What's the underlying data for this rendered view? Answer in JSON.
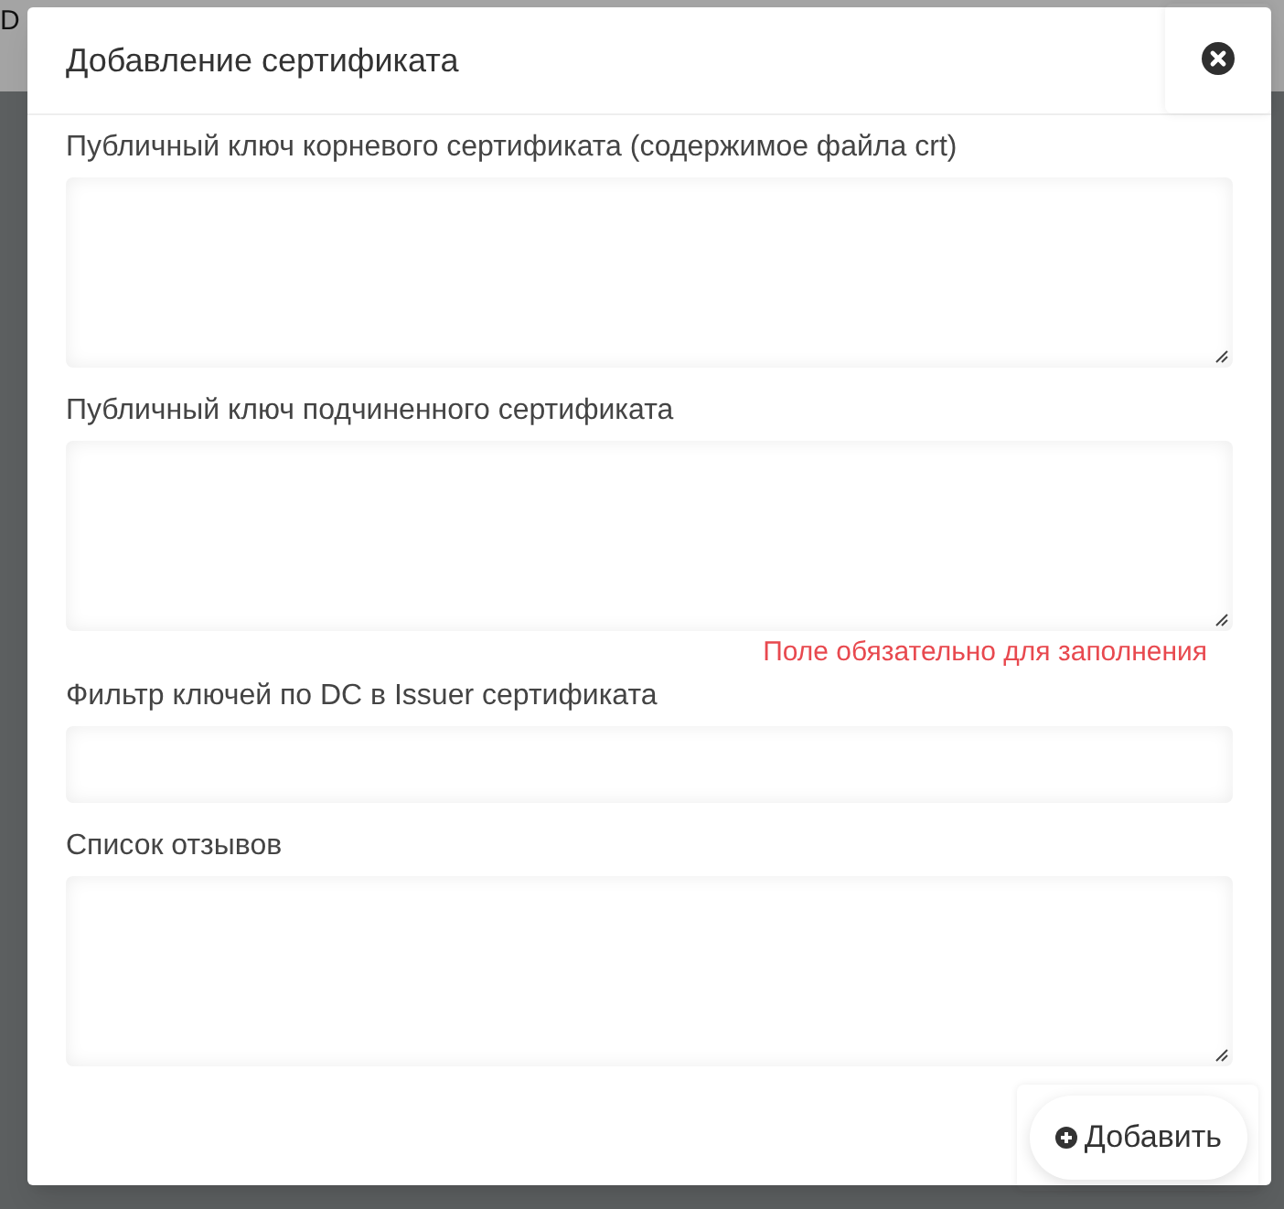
{
  "background": {
    "header_text": "D"
  },
  "dialog": {
    "title": "Добавление сертификата",
    "fields": [
      {
        "kind": "textarea",
        "label": "Публичный ключ корневого сертификата (содержимое файла crt)"
      },
      {
        "kind": "textarea",
        "label": "Публичный ключ подчиненного сертификата",
        "error": "Поле обязательно для заполнения"
      },
      {
        "kind": "input",
        "label": "Фильтр ключей по DC в Issuer сертификата"
      },
      {
        "kind": "textarea",
        "label": "Список отзывов"
      }
    ],
    "submit_button": "Добавить"
  }
}
